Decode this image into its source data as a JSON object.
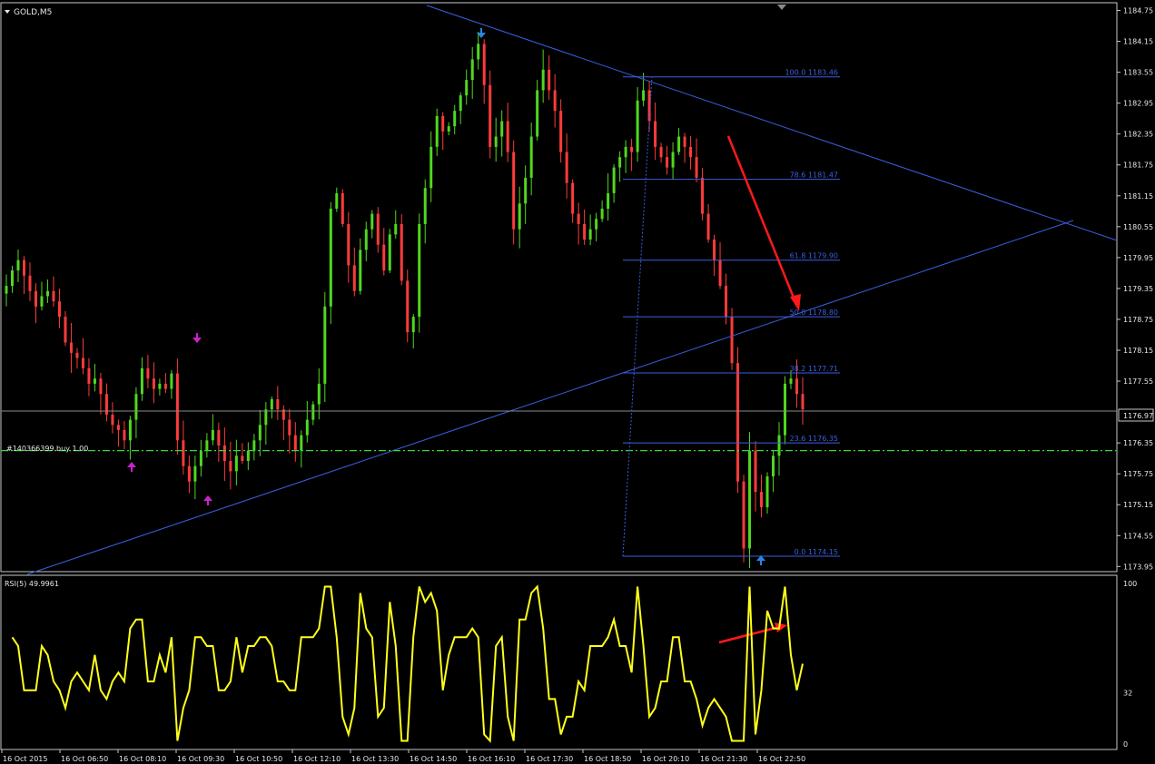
{
  "header": {
    "symbol_label": "GOLD,M5"
  },
  "rsi_label": "RSI(5) 49.9961",
  "colors": {
    "background": "#000000",
    "bull_candle": "#4fd81f",
    "bear_candle": "#ff3b3b",
    "trendline": "#3a5fdf",
    "fib": "#3a5fdf",
    "order_line": "#3ad43a",
    "rsi_line": "#ffff1a",
    "arrow_red": "#ff1a1a",
    "fractal_magenta": "#cc22cc",
    "fractal_blue": "#2c86e0",
    "axis_text": "#e8e8e8",
    "frame": "#c8c8c8"
  },
  "order": {
    "label": "#140366399 buy 1.00",
    "price": 1176.2
  },
  "current_price": {
    "label": "1176.97",
    "value": 1176.97
  },
  "price_axis": {
    "min": 1173.85,
    "max": 1184.9,
    "ticks": [
      "1184.75",
      "1184.15",
      "1183.55",
      "1182.95",
      "1182.35",
      "1181.75",
      "1181.15",
      "1180.55",
      "1179.95",
      "1179.35",
      "1178.75",
      "1178.15",
      "1177.55",
      "1176.35",
      "1175.75",
      "1175.15",
      "1174.55",
      "1173.95"
    ]
  },
  "rsi_axis": {
    "min": 0,
    "max": 100,
    "ticks": [
      "100",
      "32",
      "0"
    ]
  },
  "time_axis": {
    "labels": [
      "16 Oct 2015",
      "16 Oct 06:50",
      "16 Oct 08:10",
      "16 Oct 09:30",
      "16 Oct 10:50",
      "16 Oct 12:10",
      "16 Oct 13:30",
      "16 Oct 14:50",
      "16 Oct 16:10",
      "16 Oct 17:30",
      "16 Oct 18:50",
      "16 Oct 20:10",
      "16 Oct 21:30",
      "16 Oct 22:50"
    ]
  },
  "fib": {
    "levels": [
      {
        "label": "100.0  1183.46",
        "price": 1183.46
      },
      {
        "label": "78.6  1181.47",
        "price": 1181.47
      },
      {
        "label": "61.8  1179.90",
        "price": 1179.9
      },
      {
        "label": "50.0  1178.80",
        "price": 1178.8
      },
      {
        "label": "38.2  1177.71",
        "price": 1177.71
      },
      {
        "label": "23.6  1176.35",
        "price": 1176.35
      },
      {
        "label": "0.0  1174.15",
        "price": 1174.15
      }
    ]
  },
  "chart_data": {
    "type": "candlestick",
    "bar_interval": "M5",
    "symbol": "GOLD",
    "closes": [
      1179.4,
      1179.7,
      1179.9,
      1179.6,
      1179.3,
      1179.0,
      1179.2,
      1179.3,
      1179.1,
      1178.8,
      1178.3,
      1178.1,
      1178.0,
      1177.8,
      1177.5,
      1177.6,
      1177.3,
      1176.9,
      1176.7,
      1176.6,
      1176.4,
      1176.8,
      1177.3,
      1177.8,
      1177.6,
      1177.4,
      1177.5,
      1177.4,
      1177.7,
      1176.4,
      1175.9,
      1175.6,
      1175.9,
      1176.2,
      1176.4,
      1176.6,
      1176.3,
      1176.0,
      1175.8,
      1176.1,
      1176.0,
      1176.2,
      1176.4,
      1176.7,
      1177.0,
      1177.2,
      1177.0,
      1176.8,
      1176.5,
      1176.2,
      1176.5,
      1176.8,
      1177.1,
      1177.5,
      1179.0,
      1180.9,
      1181.2,
      1180.6,
      1179.8,
      1179.3,
      1180.1,
      1180.5,
      1180.8,
      1180.2,
      1179.7,
      1180.4,
      1180.6,
      1179.5,
      1178.5,
      1178.8,
      1180.6,
      1181.3,
      1182.1,
      1182.7,
      1182.4,
      1182.5,
      1182.8,
      1183.1,
      1183.4,
      1183.8,
      1184.1,
      1183.3,
      1182.1,
      1182.3,
      1182.6,
      1182.0,
      1180.5,
      1181.0,
      1181.5,
      1182.3,
      1183.2,
      1183.6,
      1183.2,
      1182.8,
      1182.0,
      1181.4,
      1180.8,
      1180.6,
      1180.3,
      1180.5,
      1180.7,
      1180.9,
      1181.2,
      1181.7,
      1181.9,
      1182.1,
      1182.0,
      1183.0,
      1183.2,
      1182.6,
      1182.1,
      1181.9,
      1181.7,
      1182.0,
      1182.3,
      1182.1,
      1181.9,
      1181.5,
      1180.8,
      1180.3,
      1179.9,
      1179.4,
      1178.8,
      1177.9,
      1175.6,
      1174.3,
      1176.2,
      1175.4,
      1175.1,
      1175.7,
      1176.1,
      1176.5,
      1177.5,
      1177.6,
      1177.3,
      1177.0
    ],
    "rsi_period": 5,
    "rsi_last": 49.9961,
    "order": {
      "ticket": "#140366399",
      "side": "buy",
      "volume": 1.0,
      "price": 1176.2
    },
    "fib_retracement": {
      "high": 1183.46,
      "low": 1174.15
    },
    "xlabel": "",
    "ylabel": ""
  }
}
